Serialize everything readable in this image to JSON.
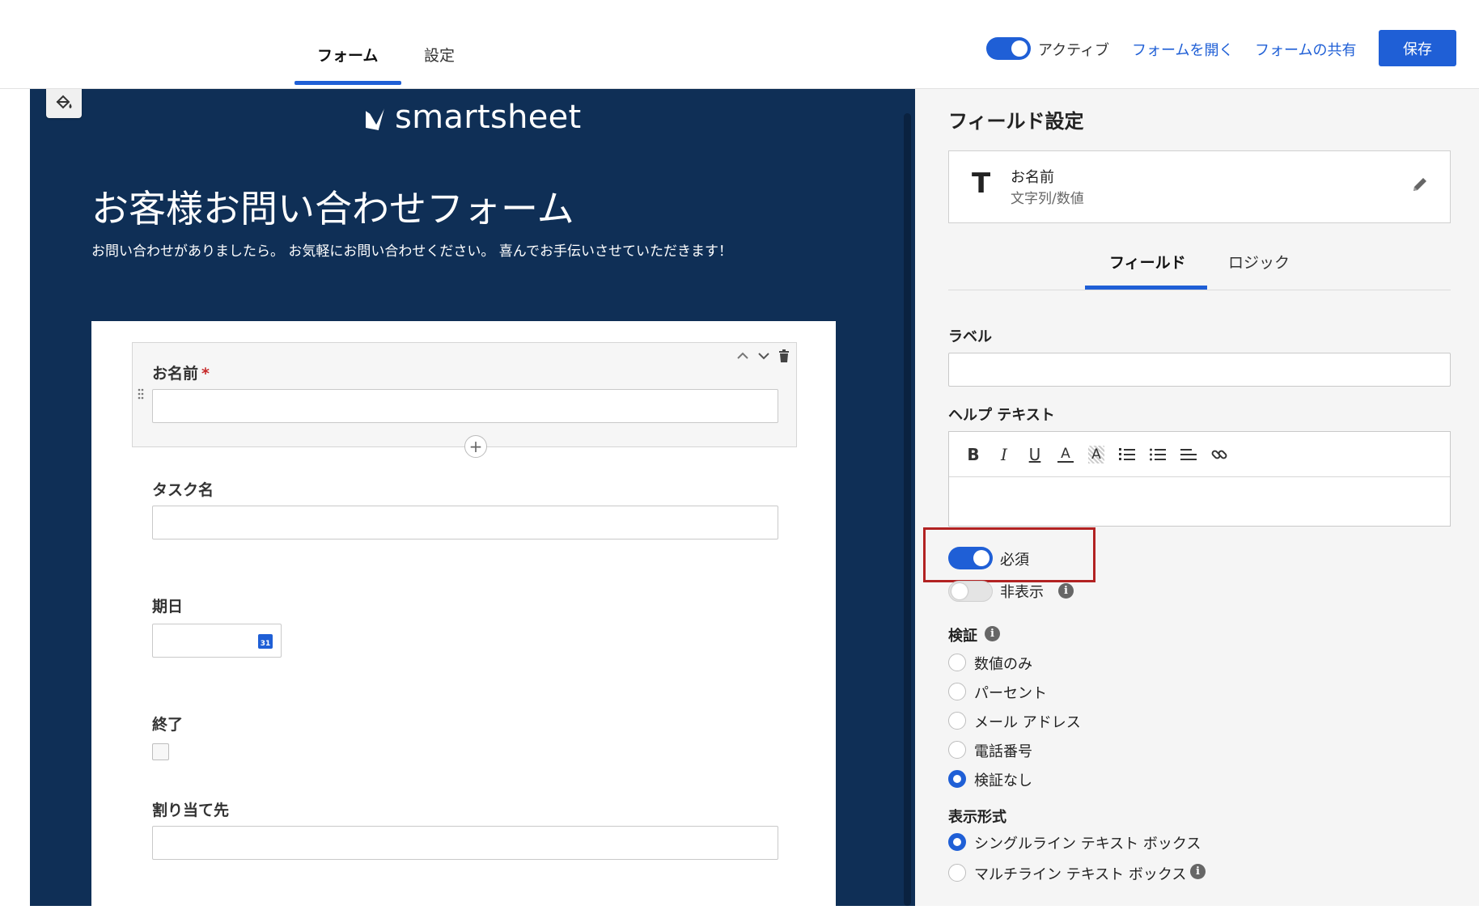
{
  "topbar": {
    "tabs": [
      "フォーム",
      "設定"
    ],
    "active_label": "アクティブ",
    "open_form": "フォームを開く",
    "share_form": "フォームの共有",
    "save": "保存"
  },
  "form": {
    "logo_text": "smartsheet",
    "title": "お客様お問い合わせフォーム",
    "description": "お問い合わせがありましたら。 お気軽にお問い合わせください。 喜んでお手伝いさせていただきます！",
    "fields": [
      {
        "label": "お名前",
        "required_mark": "*"
      },
      {
        "label": "タスク名"
      },
      {
        "label": "期日",
        "calendar_day": "31"
      },
      {
        "label": "終了"
      },
      {
        "label": "割り当て先"
      }
    ]
  },
  "panel": {
    "title": "フィールド設定",
    "card": {
      "type_icon": "T",
      "name": "お名前",
      "type": "文字列/数値"
    },
    "tabs": [
      "フィールド",
      "ロジック"
    ],
    "label_heading": "ラベル",
    "help_heading": "ヘルプ テキスト",
    "toolbar": [
      "B",
      "I",
      "U",
      "A",
      "A"
    ],
    "required": "必須",
    "hidden": "非表示",
    "validation_heading": "検証",
    "validation_options": [
      "数値のみ",
      "パーセント",
      "メール アドレス",
      "電話番号",
      "検証なし"
    ],
    "display_heading": "表示形式",
    "display_options": [
      "シングルライン テキスト ボックス",
      "マルチライン テキスト ボックス"
    ],
    "info_glyph": "i"
  },
  "colors": {
    "accent": "#1f5fd6",
    "canvas": "#0f2f56",
    "highlight": "#b22222"
  }
}
